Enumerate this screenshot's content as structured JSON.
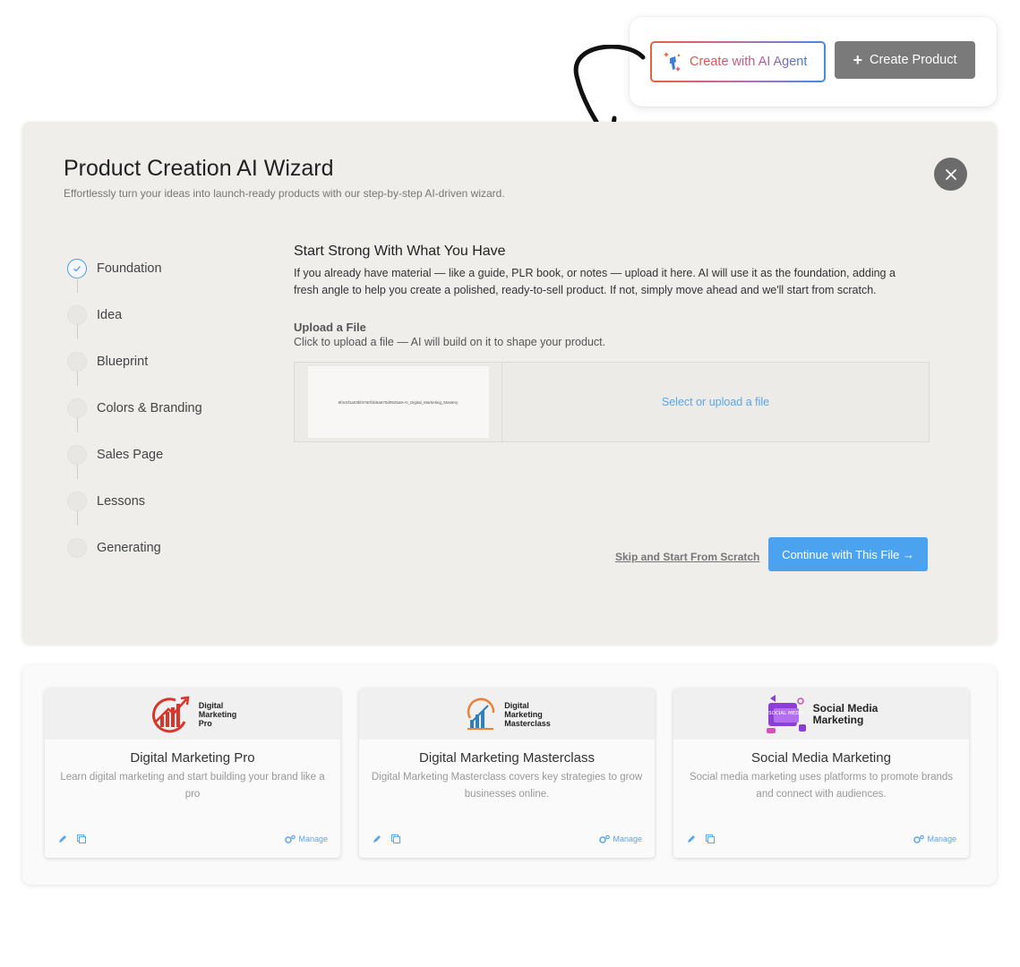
{
  "top_actions": {
    "ai_button_label": "Create with AI Agent",
    "create_button_label": "Create Product",
    "create_button_icon": "plus-icon"
  },
  "wizard": {
    "title": "Product Creation AI Wizard",
    "subtitle": "Effortlessly turn your ideas into launch-ready products with our step-by-step AI-driven wizard.",
    "steps": [
      {
        "label": "Foundation",
        "active": true
      },
      {
        "label": "Idea",
        "active": false
      },
      {
        "label": "Blueprint",
        "active": false
      },
      {
        "label": "Colors & Branding",
        "active": false
      },
      {
        "label": "Sales Page",
        "active": false
      },
      {
        "label": "Lessons",
        "active": false
      },
      {
        "label": "Generating",
        "active": false
      }
    ],
    "content": {
      "title": "Start Strong With What You Have",
      "description": "If you already have material — like a guide, PLR book, or notes — upload it here. AI will use it as the foundation, adding a fresh angle to help you create a polished, ready-to-sell product. If not, simply move ahead and we'll start from scratch.",
      "upload_title": "Upload a File",
      "upload_subtitle": "Click to upload a file — AI will build on it to shape your product.",
      "file_preview_name": "5f4c6f1a03bf4760f1b6a670d0525a9-AI_Digital_Marketing_Mastery",
      "select_text": "Select or upload a file"
    },
    "skip_label": "Skip and Start From Scratch",
    "continue_label": "Continue with This File →"
  },
  "products": [
    {
      "logo_lines": [
        "Digital",
        "Marketing",
        "Pro"
      ],
      "title": "Digital Marketing Pro",
      "description": "Learn digital marketing and start building your brand like a pro",
      "manage_label": "Manage"
    },
    {
      "logo_lines": [
        "Digital",
        "Marketing",
        "Masterclass"
      ],
      "title": "Digital Marketing Masterclass",
      "description": "Digital Marketing Masterclass covers key strategies to grow businesses online.",
      "manage_label": "Manage"
    },
    {
      "logo_lines": [
        "Social Media",
        "Marketing"
      ],
      "logo_badge": "SOCIAL MEDIA",
      "title": "Social Media Marketing",
      "description": "Social media marketing uses platforms to promote brands and connect with audiences.",
      "manage_label": "Manage"
    }
  ],
  "colors": {
    "accent_blue": "#4ba3ef",
    "link_blue": "#5aa6e8",
    "neutral_button": "#7a7a7a",
    "wizard_bg": "#efeeeb"
  }
}
